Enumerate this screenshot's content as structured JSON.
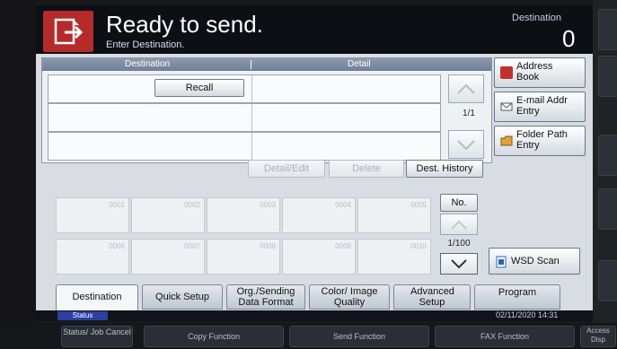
{
  "header": {
    "title": "Ready to send.",
    "subtitle": "Enter Destination.",
    "destination_label": "Destination",
    "destination_count": "0"
  },
  "table": {
    "col_destination": "Destination",
    "col_detail": "Detail",
    "recall_label": "Recall",
    "page": "1/1"
  },
  "side_buttons": {
    "address_book": "Address Book",
    "email_addr_entry": "E-mail Addr Entry",
    "folder_path_entry": "Folder Path Entry",
    "wsd_scan": "WSD Scan"
  },
  "actions": {
    "detail_edit": "Detail/Edit",
    "delete": "Delete",
    "dest_history": "Dest. History",
    "no": "No.",
    "page": "1/100"
  },
  "speed_dials": [
    "0001",
    "0002",
    "0003",
    "0004",
    "0005",
    "0006",
    "0007",
    "0008",
    "0009",
    "0010"
  ],
  "tabs": [
    {
      "label": "Destination"
    },
    {
      "label": "Quick Setup"
    },
    {
      "label": "Org./Sending Data Format"
    },
    {
      "label": "Color/ Image Quality"
    },
    {
      "label": "Advanced Setup"
    },
    {
      "label": "Program"
    }
  ],
  "status": {
    "label": "Status",
    "datetime": "02/11/2020  14:31"
  },
  "hardware": {
    "status_job_cancel": "Status/ Job Cancel",
    "copy_function": "Copy Function",
    "send_function": "Send Function",
    "fax_function": "FAX Function",
    "access_display": "Access Disp"
  },
  "colors": {
    "icon_red": "#b52a2a",
    "header_bg": "#0c0f14",
    "status_blue": "#2a3fa0"
  }
}
